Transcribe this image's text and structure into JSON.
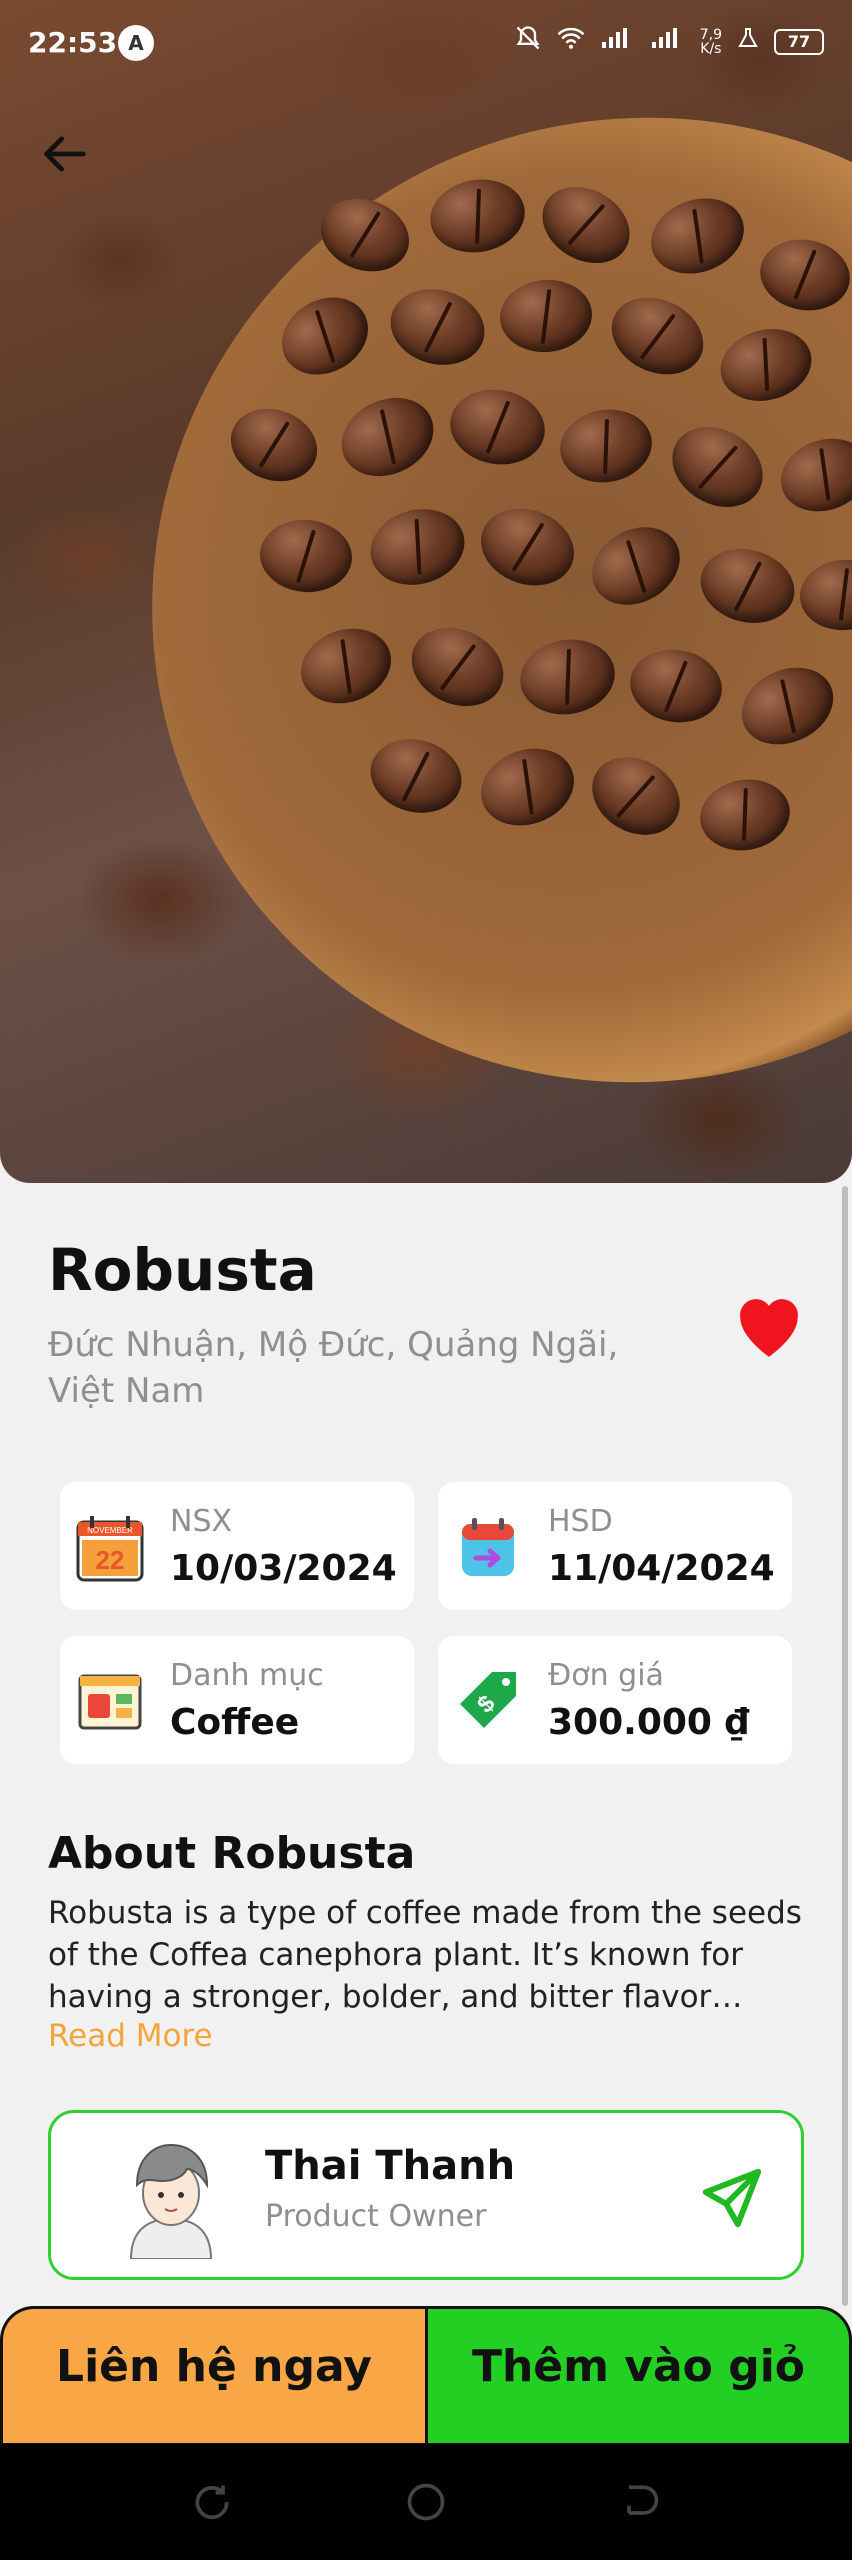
{
  "status_bar": {
    "time": "22:53",
    "badge": "A",
    "speed": "7,9\nK/s",
    "battery": "77"
  },
  "product": {
    "name": "Robusta",
    "address": "Đức Nhuận, Mộ Đức, Quảng Ngãi, Việt Nam",
    "favorite": true
  },
  "info_cards": {
    "nsx": {
      "label": "NSX",
      "value": "10/03/2024",
      "icon": "calendar-icon"
    },
    "hsd": {
      "label": "HSD",
      "value": "11/04/2024",
      "icon": "calendar-arrow-icon"
    },
    "category": {
      "label": "Danh mục",
      "value": "Coffee",
      "icon": "category-icon"
    },
    "price": {
      "label": "Đơn giá",
      "value": "300.000 ₫",
      "icon": "price-tag-icon"
    }
  },
  "about": {
    "heading": "About Robusta",
    "text": "Robusta is a type of coffee made from the seeds of the Coffea canephora plant. It’s known for having a stronger, bolder, and bitter flavor profile compare...",
    "read_more": "Read More"
  },
  "owner": {
    "name": "Thai Thanh",
    "role": "Product Owner"
  },
  "actions": {
    "contact": "Liên hệ ngay",
    "add_to_cart": "Thêm vào giỏ"
  },
  "colors": {
    "accent_orange": "#f8a646",
    "accent_green": "#22cf22",
    "heart_red": "#f0141e",
    "read_more": "#f4a43a"
  }
}
